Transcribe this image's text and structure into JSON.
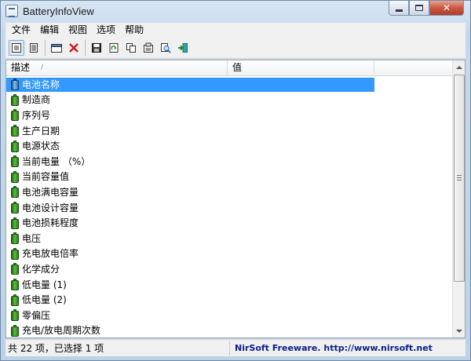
{
  "window": {
    "title": "BatteryInfoView",
    "controls": {
      "minimize": "minimize-icon",
      "maximize": "maximize-icon",
      "close": "close-icon"
    }
  },
  "menu": {
    "items": [
      {
        "label": "文件"
      },
      {
        "label": "编辑"
      },
      {
        "label": "视图"
      },
      {
        "label": "选项"
      },
      {
        "label": "帮助"
      }
    ]
  },
  "toolbar": {
    "buttons": [
      {
        "icon": "battery-info-mode-icon",
        "active": true
      },
      {
        "icon": "log-mode-icon",
        "active": false
      },
      {
        "icon": "window-icon",
        "active": false
      },
      {
        "icon": "delete-icon",
        "active": false
      },
      {
        "icon": "save-icon",
        "active": false
      },
      {
        "icon": "refresh-icon",
        "active": false
      },
      {
        "icon": "copy-icon",
        "active": false
      },
      {
        "icon": "properties-icon",
        "active": false
      },
      {
        "icon": "find-icon",
        "active": false
      },
      {
        "icon": "exit-icon",
        "active": false
      }
    ]
  },
  "list": {
    "columns": [
      {
        "label": "描述",
        "sort_indicator": "/"
      },
      {
        "label": "值"
      }
    ],
    "rows": [
      {
        "label": "电池名称",
        "selected": true
      },
      {
        "label": "制造商"
      },
      {
        "label": "序列号"
      },
      {
        "label": "生产日期"
      },
      {
        "label": "电源状态"
      },
      {
        "label": "当前电量 （%）"
      },
      {
        "label": "当前容量值"
      },
      {
        "label": "电池满电容量"
      },
      {
        "label": "电池设计容量"
      },
      {
        "label": "电池损耗程度"
      },
      {
        "label": "电压"
      },
      {
        "label": "充电放电倍率"
      },
      {
        "label": "化学成分"
      },
      {
        "label": "低电量 (1)"
      },
      {
        "label": "低电量 (2)"
      },
      {
        "label": "零偏压"
      },
      {
        "label": "充电/放电周期次数"
      }
    ]
  },
  "status": {
    "count_text": "共 22 项，已选择 1 项",
    "link_text": "NirSoft Freeware.  http://www.nirsoft.net"
  },
  "colors": {
    "selection": "#3399ff",
    "battery_green": "#3f9a2c",
    "link": "#0a1f8a",
    "close_button": "#c75a46"
  }
}
